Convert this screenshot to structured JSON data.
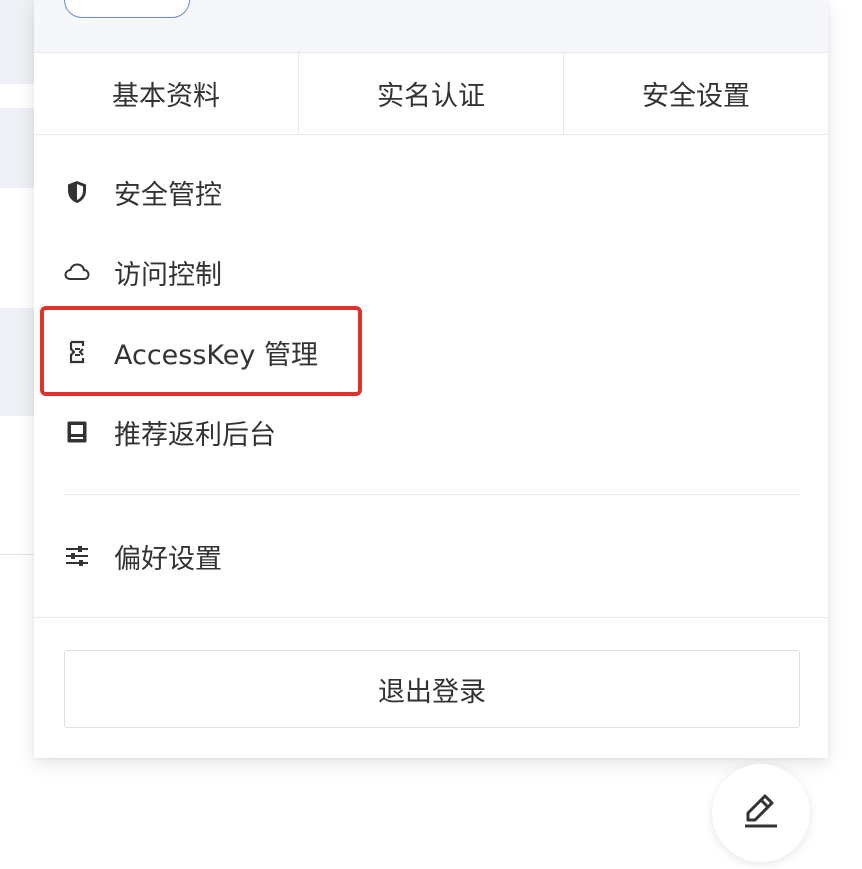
{
  "tabs": [
    {
      "label": "基本资料"
    },
    {
      "label": "实名认证"
    },
    {
      "label": "安全设置"
    }
  ],
  "menu": {
    "items": [
      {
        "label": "安全管控",
        "icon": "shield-icon"
      },
      {
        "label": "访问控制",
        "icon": "cloud-icon"
      },
      {
        "label": "AccessKey 管理",
        "icon": "key-bracket-icon"
      },
      {
        "label": "推荐返利后台",
        "icon": "panel-icon"
      }
    ],
    "preferences": {
      "label": "偏好设置",
      "icon": "sliders-icon"
    }
  },
  "logout_label": "退出登录",
  "fab": {
    "icon": "edit-pen-icon"
  },
  "colors": {
    "highlight": "#e0322a",
    "pill_border": "#6a8fd8",
    "text": "#333333"
  }
}
